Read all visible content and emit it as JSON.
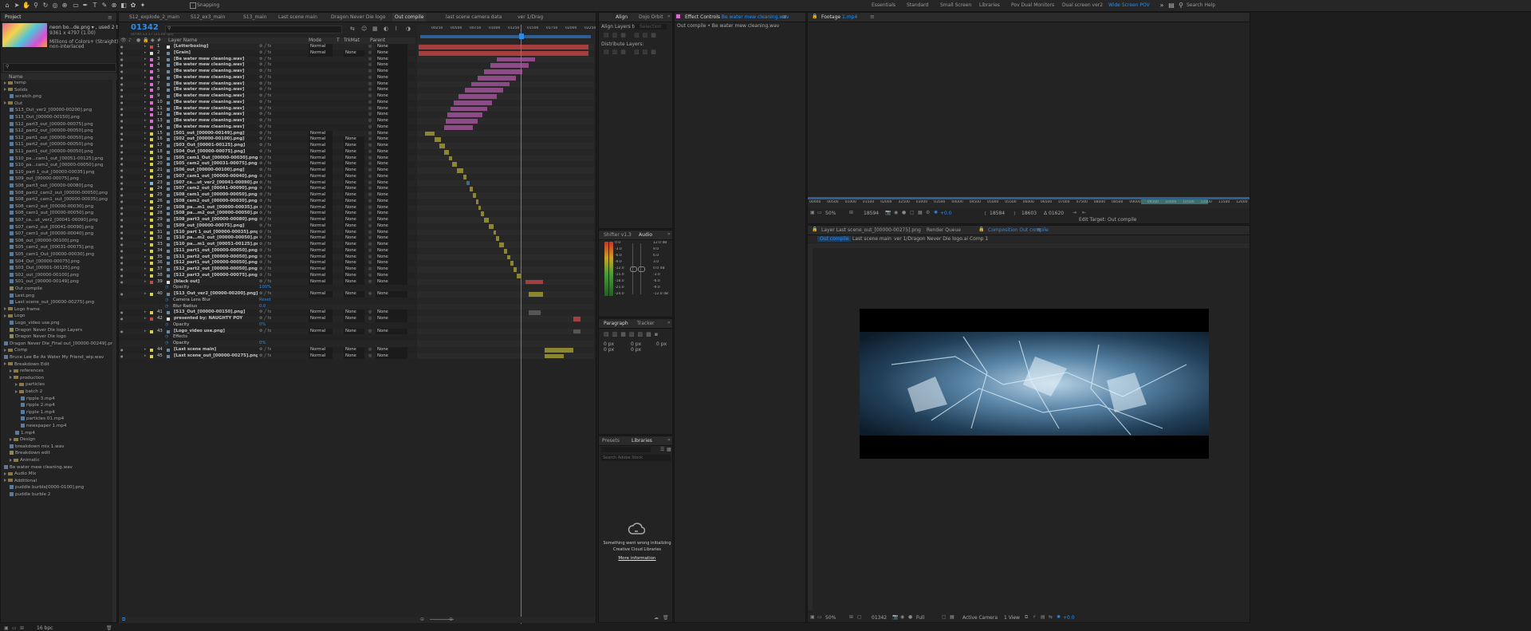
{
  "workspaces": [
    "Essentials",
    "Standard",
    "Small Screen",
    "Libraries",
    "Pov Dual Monitors",
    "Dual screen ver2",
    "Wide Screen POV"
  ],
  "snapping": "Snapping",
  "search_help": "Search Help",
  "project": {
    "tab": "Project",
    "thumb_name": "neon bo...de.png ▾ , used 2 times",
    "thumb_dims": "9361 x 4797 (1.00)",
    "thumb_colors": "Millions of Colors+ (Straight)",
    "thumb_interlace": "non-interlaced",
    "col_name": "Name",
    "bpc": "16 bpc",
    "items": [
      {
        "d": 0,
        "t": "folder",
        "n": "temp"
      },
      {
        "d": 0,
        "t": "folder",
        "n": "Solids"
      },
      {
        "d": 1,
        "t": "file",
        "n": "scratch.png"
      },
      {
        "d": 0,
        "t": "folder",
        "n": "Out"
      },
      {
        "d": 1,
        "t": "file",
        "n": "S13_Out_ver2_[00000-00200].png"
      },
      {
        "d": 1,
        "t": "file",
        "n": "S13_Out_[00000-00150].png"
      },
      {
        "d": 1,
        "t": "file",
        "n": "S12_part3_out_[00000-00075].png"
      },
      {
        "d": 1,
        "t": "file",
        "n": "S12_part2_out_[00000-00050].png"
      },
      {
        "d": 1,
        "t": "file",
        "n": "S12_part1_out_[00000-00050].png"
      },
      {
        "d": 1,
        "t": "file",
        "n": "S11_part2_out_[00000-00050].png"
      },
      {
        "d": 1,
        "t": "file",
        "n": "S11_part1_out_[00000-00050].png"
      },
      {
        "d": 1,
        "t": "file",
        "n": "S10_pa...cam1_out_[00051-00125].png"
      },
      {
        "d": 1,
        "t": "file",
        "n": "S10_pa...cam2_out_[00000-00050].png"
      },
      {
        "d": 1,
        "t": "file",
        "n": "S10_part 1_out_[00000-00035].png"
      },
      {
        "d": 1,
        "t": "file",
        "n": "S09_out_[00000-00075].png"
      },
      {
        "d": 1,
        "t": "file",
        "n": "S08_part3_out_[00000-00080].png"
      },
      {
        "d": 1,
        "t": "file",
        "n": "S08_part2_cam2_out_[00000-00050].png"
      },
      {
        "d": 1,
        "t": "file",
        "n": "S08_part2_cam1_out_[00000-00035].png"
      },
      {
        "d": 1,
        "t": "file",
        "n": "S08_cam2_out_[00000-00030].png"
      },
      {
        "d": 1,
        "t": "file",
        "n": "S08_cam1_out_[00000-00050].png"
      },
      {
        "d": 1,
        "t": "file",
        "n": "S07_ca...ut_ver2_[00041-00090].png"
      },
      {
        "d": 1,
        "t": "file",
        "n": "S07_cam2_out_[00041-00090].png"
      },
      {
        "d": 1,
        "t": "file",
        "n": "S07_cam1_out_[00000-00040].png"
      },
      {
        "d": 1,
        "t": "file",
        "n": "S06_out_[00000-00100].png"
      },
      {
        "d": 1,
        "t": "file",
        "n": "S05_cam2_out_[00031-00075].png"
      },
      {
        "d": 1,
        "t": "file",
        "n": "S05_cam1_Out_[00000-00030].png"
      },
      {
        "d": 1,
        "t": "file",
        "n": "S04_Out_[00000-00075].png"
      },
      {
        "d": 1,
        "t": "file",
        "n": "S03_Out_[00001-00125].png"
      },
      {
        "d": 1,
        "t": "file",
        "n": "S02_out_[00000-00100].png"
      },
      {
        "d": 1,
        "t": "file",
        "n": "S01_out_[00000-00149].png"
      },
      {
        "d": 1,
        "t": "comp",
        "n": "Out compile"
      },
      {
        "d": 1,
        "t": "file",
        "n": "Lest.png"
      },
      {
        "d": 1,
        "t": "file",
        "n": "Last scene_out_[00000-00275].png"
      },
      {
        "d": 0,
        "t": "folder",
        "n": "Logo frame"
      },
      {
        "d": 0,
        "t": "folder",
        "n": "Logo"
      },
      {
        "d": 1,
        "t": "file",
        "n": "Logo_video use.png"
      },
      {
        "d": 1,
        "t": "comp",
        "n": "Dragon Never Die logo Layers"
      },
      {
        "d": 1,
        "t": "comp",
        "n": "Dragon Never Die logo"
      },
      {
        "d": 0,
        "t": "file",
        "n": "Dragon Never Die_Final out_[00000-00249].png"
      },
      {
        "d": 0,
        "t": "folder",
        "n": "Comp"
      },
      {
        "d": 0,
        "t": "file",
        "n": "Bruce Lee Be As Water My Friend_wip.wav"
      },
      {
        "d": 0,
        "t": "folder",
        "n": "Breakdown Edit"
      },
      {
        "d": 1,
        "t": "folder",
        "n": "references"
      },
      {
        "d": 1,
        "t": "folder",
        "n": "production"
      },
      {
        "d": 2,
        "t": "folder",
        "n": "particles"
      },
      {
        "d": 2,
        "t": "folder",
        "n": "batch 2"
      },
      {
        "d": 3,
        "t": "file",
        "n": "ripple 3.mp4"
      },
      {
        "d": 3,
        "t": "file",
        "n": "ripple 2.mp4"
      },
      {
        "d": 3,
        "t": "file",
        "n": "ripple 1.mp4"
      },
      {
        "d": 3,
        "t": "file",
        "n": "particles 01.mp4"
      },
      {
        "d": 3,
        "t": "file",
        "n": "newspaper 1.mp4"
      },
      {
        "d": 2,
        "t": "file",
        "n": "1.mp4"
      },
      {
        "d": 1,
        "t": "folder",
        "n": "Design"
      },
      {
        "d": 1,
        "t": "file",
        "n": "breakdown mix 1.wav"
      },
      {
        "d": 1,
        "t": "comp",
        "n": "Breakdown edit"
      },
      {
        "d": 1,
        "t": "folder",
        "n": "Animatic"
      },
      {
        "d": 0,
        "t": "file",
        "n": "Be water mew cleaning.wav"
      },
      {
        "d": 0,
        "t": "folder",
        "n": "Audio Mix"
      },
      {
        "d": 0,
        "t": "folder",
        "n": "Additional"
      },
      {
        "d": 1,
        "t": "file",
        "n": "puddle burble[0000-0100].png"
      },
      {
        "d": 1,
        "t": "file",
        "n": "puddle burble 2"
      }
    ]
  },
  "timeline": {
    "tabs": [
      "S12_explode_2_main",
      "S12_ex3_main",
      "S13_main",
      "Last scene main",
      "Dragon Never Die logo",
      "Out compile",
      "last scene camera data",
      "ver 1/Drag"
    ],
    "active_tab": 5,
    "timecode": "01342",
    "timecode_sub": "00:00:53:17 (25.00 fps)",
    "col_layer_name": "Layer Name",
    "col_mode": "Mode",
    "col_t": "T",
    "col_trkmat": "TrkMat",
    "col_parent": "Parent",
    "ruler": [
      "00250",
      "00500",
      "00750",
      "01000",
      "01250",
      "01500",
      "01750",
      "02000",
      "02250"
    ],
    "layers": [
      {
        "n": "1",
        "name": "[Letterboxing]",
        "c": "#c24b4b",
        "mode": "Normal",
        "trk": "",
        "par": "None"
      },
      {
        "n": "2",
        "name": "[Grain]",
        "c": "#d9d9d9",
        "mode": "Normal",
        "trk": "None",
        "par": "None"
      },
      {
        "n": "3",
        "name": "[Be water mew cleaning.wav]",
        "c": "#d56fd0",
        "mode": "",
        "trk": "",
        "par": "None"
      },
      {
        "n": "4",
        "name": "[Be water mew cleaning.wav]",
        "c": "#d56fd0",
        "mode": "",
        "trk": "",
        "par": "None"
      },
      {
        "n": "5",
        "name": "[Be water mew cleaning.wav]",
        "c": "#d56fd0",
        "mode": "",
        "trk": "",
        "par": "None"
      },
      {
        "n": "6",
        "name": "[Be water mew cleaning.wav]",
        "c": "#d56fd0",
        "mode": "",
        "trk": "",
        "par": "None"
      },
      {
        "n": "7",
        "name": "[Be water mew cleaning.wav]",
        "c": "#d56fd0",
        "mode": "",
        "trk": "",
        "par": "None"
      },
      {
        "n": "8",
        "name": "[Be water mew cleaning.wav]",
        "c": "#d56fd0",
        "mode": "",
        "trk": "",
        "par": "None"
      },
      {
        "n": "9",
        "name": "[Be water mew cleaning.wav]",
        "c": "#d56fd0",
        "mode": "",
        "trk": "",
        "par": "None"
      },
      {
        "n": "10",
        "name": "[Be water mew cleaning.wav]",
        "c": "#d56fd0",
        "mode": "",
        "trk": "",
        "par": "None"
      },
      {
        "n": "11",
        "name": "[Be water mew cleaning.wav]",
        "c": "#d56fd0",
        "mode": "",
        "trk": "",
        "par": "None"
      },
      {
        "n": "12",
        "name": "[Be water mew cleaning.wav]",
        "c": "#d56fd0",
        "mode": "",
        "trk": "",
        "par": "None"
      },
      {
        "n": "13",
        "name": "[Be water mew cleaning.wav]",
        "c": "#d56fd0",
        "mode": "",
        "trk": "",
        "par": "None"
      },
      {
        "n": "14",
        "name": "[Be water mew cleaning.wav]",
        "c": "#d56fd0",
        "mode": "",
        "trk": "",
        "par": "None"
      },
      {
        "n": "15",
        "name": "[S01_out_[00000-00149].png]",
        "c": "#d8cf4a",
        "mode": "Normal",
        "trk": "",
        "par": "None"
      },
      {
        "n": "16",
        "name": "[S02_out_[00000-00100].png]",
        "c": "#d8cf4a",
        "mode": "Normal",
        "trk": "None",
        "par": "None"
      },
      {
        "n": "17",
        "name": "[S03_Out_[00001-00125].png]",
        "c": "#d8cf4a",
        "mode": "Normal",
        "trk": "None",
        "par": "None"
      },
      {
        "n": "18",
        "name": "[S04_Out_[00000-00075].png]",
        "c": "#d8cf4a",
        "mode": "Normal",
        "trk": "None",
        "par": "None"
      },
      {
        "n": "19",
        "name": "[S05_cam1_Out_[00000-00030].png]",
        "c": "#d8cf4a",
        "mode": "Normal",
        "trk": "None",
        "par": "None"
      },
      {
        "n": "20",
        "name": "[S05_cam2_out_[00031-00075].png]",
        "c": "#d8cf4a",
        "mode": "Normal",
        "trk": "None",
        "par": "None"
      },
      {
        "n": "21",
        "name": "[S06_out_[00000-00100].png]",
        "c": "#d8cf4a",
        "mode": "Normal",
        "trk": "None",
        "par": "None"
      },
      {
        "n": "22",
        "name": "[S07_cam1_out_[00000-00040].png]",
        "c": "#d8cf4a",
        "mode": "Normal",
        "trk": "None",
        "par": "None"
      },
      {
        "n": "23",
        "name": "[S07_ca...ut_ver2_[00041-00090].png]",
        "c": "#7fb6d9",
        "mode": "Normal",
        "trk": "None",
        "par": "None"
      },
      {
        "n": "24",
        "name": "[S07_cam2_out_[00041-00090].png]",
        "c": "#d8cf4a",
        "mode": "Normal",
        "trk": "None",
        "par": "None"
      },
      {
        "n": "25",
        "name": "[S08_cam1_out_[00000-00050].png]",
        "c": "#d8cf4a",
        "mode": "Normal",
        "trk": "None",
        "par": "None"
      },
      {
        "n": "26",
        "name": "[S08_cam2_out_[00000-00030].png]",
        "c": "#d8cf4a",
        "mode": "Normal",
        "trk": "None",
        "par": "None"
      },
      {
        "n": "27",
        "name": "[S08_pa...m1_out_[00000-00035].png]",
        "c": "#d8cf4a",
        "mode": "Normal",
        "trk": "None",
        "par": "None"
      },
      {
        "n": "28",
        "name": "[S08_pa...m2_out_[00000-00050].png]",
        "c": "#d8cf4a",
        "mode": "Normal",
        "trk": "None",
        "par": "None"
      },
      {
        "n": "29",
        "name": "[S08_part3_out_[00000-00080].png]",
        "c": "#d8cf4a",
        "mode": "Normal",
        "trk": "None",
        "par": "None"
      },
      {
        "n": "30",
        "name": "[S09_out_[00000-00075].png]",
        "c": "#d8cf4a",
        "mode": "Normal",
        "trk": "None",
        "par": "None"
      },
      {
        "n": "31",
        "name": "[S10_part 1_out_[00000-00035].png]",
        "c": "#d8cf4a",
        "mode": "Normal",
        "trk": "None",
        "par": "None"
      },
      {
        "n": "32",
        "name": "[S10_pa...m2_out_[00000-00050].png]",
        "c": "#d8cf4a",
        "mode": "Normal",
        "trk": "None",
        "par": "None"
      },
      {
        "n": "33",
        "name": "[S10_pa...m1_out_[00051-00125].png]",
        "c": "#d8cf4a",
        "mode": "Normal",
        "trk": "None",
        "par": "None"
      },
      {
        "n": "34",
        "name": "[S11_part1_out_[00000-00050].png]",
        "c": "#d8cf4a",
        "mode": "Normal",
        "trk": "None",
        "par": "None"
      },
      {
        "n": "35",
        "name": "[S11_part2_out_[00000-00050].png]",
        "c": "#d8cf4a",
        "mode": "Normal",
        "trk": "None",
        "par": "None"
      },
      {
        "n": "36",
        "name": "[S12_part1_out_[00000-00050].png]",
        "c": "#d8cf4a",
        "mode": "Normal",
        "trk": "None",
        "par": "None"
      },
      {
        "n": "37",
        "name": "[S12_part2_out_[00000-00050].png]",
        "c": "#d8cf4a",
        "mode": "Normal",
        "trk": "None",
        "par": "None"
      },
      {
        "n": "38",
        "name": "[S12_part3_out_[00000-00075].png]",
        "c": "#d8cf4a",
        "mode": "Normal",
        "trk": "None",
        "par": "None"
      },
      {
        "n": "39",
        "name": "[black out]",
        "c": "#c24b4b",
        "mode": "Normal",
        "trk": "None",
        "par": "None"
      },
      {
        "n": "",
        "name": "Opacity",
        "c": "",
        "mode": "",
        "trk": "",
        "par": "",
        "sub": true,
        "val": "100%"
      },
      {
        "n": "40",
        "name": "[S13_Out_ver2_[00000-00200].png]",
        "c": "#d8cf4a",
        "mode": "Normal",
        "trk": "None",
        "par": "None"
      },
      {
        "n": "",
        "name": "Camera Lens Blur",
        "c": "",
        "mode": "",
        "trk": "",
        "par": "",
        "sub": true,
        "val": "Reset"
      },
      {
        "n": "",
        "name": "Blur Radius",
        "c": "",
        "mode": "",
        "trk": "",
        "par": "",
        "sub": true,
        "val": "0.0"
      },
      {
        "n": "41",
        "name": "[S13_Out_[00000-00150].png]",
        "c": "#d8cf4a",
        "mode": "Normal",
        "trk": "None",
        "par": "None"
      },
      {
        "n": "42",
        "name": "presented by: NAUGHTY POY",
        "c": "#c24b4b",
        "mode": "Normal",
        "trk": "None",
        "par": "None"
      },
      {
        "n": "",
        "name": "Opacity",
        "c": "",
        "mode": "",
        "trk": "",
        "par": "",
        "sub": true,
        "val": "0%"
      },
      {
        "n": "43",
        "name": "[Logo_video use.png]",
        "c": "#d8cf4a",
        "mode": "Normal",
        "trk": "None",
        "par": "None"
      },
      {
        "n": "",
        "name": "Effects",
        "c": "",
        "mode": "",
        "trk": "",
        "par": "",
        "sub": true,
        "val": ""
      },
      {
        "n": "",
        "name": "Opacity",
        "c": "",
        "mode": "",
        "trk": "",
        "par": "",
        "sub": true,
        "val": "0%"
      },
      {
        "n": "44",
        "name": "[Last scene main]",
        "c": "#d8cf4a",
        "mode": "Normal",
        "trk": "None",
        "par": "None"
      },
      {
        "n": "45",
        "name": "[Last scene_out_[00000-00275].png]",
        "c": "#d8cf4a",
        "mode": "Normal",
        "trk": "None",
        "par": "None"
      }
    ]
  },
  "align": {
    "tabs": [
      "Align",
      "Dojo Orbit"
    ],
    "align_layers_to": "Align Layers to:",
    "selection": "Selection",
    "distribute": "Distribute Layers:"
  },
  "effect_controls": {
    "tab": "Effect Controls",
    "tab_file": "Be water mew cleaning.wav",
    "path": "Out compile • Be water mew cleaning.wav"
  },
  "audio": {
    "tabs": [
      "Shifter v1.3",
      "Audio"
    ],
    "levels_left": [
      "0.0",
      "-3.0",
      "-6.0",
      "-9.0",
      "-12.0",
      "-15.0",
      "-18.0",
      "-21.0",
      "-24.0"
    ],
    "levels_right": [
      "12.0 dB",
      "9.0",
      "6.0",
      "3.0",
      "0.0 dB",
      "-3.0",
      "-6.0",
      "-9.0",
      "-12.0 dB"
    ]
  },
  "paragraph": {
    "tabs": [
      "Paragraph",
      "Tracker"
    ],
    "values": [
      "0 px",
      "0 px",
      "0 px",
      "0 px",
      "0 px"
    ]
  },
  "libraries": {
    "tabs": [
      "Presets",
      "Libraries"
    ],
    "search": "Search Adobe Stock",
    "error1": "Something went wrong initializing",
    "error2": "Creative Cloud Libraries",
    "more": "More information"
  },
  "footage": {
    "tab": "Footage",
    "file": "1.mp4",
    "ruler": [
      "00000",
      "00500",
      "01000",
      "01500",
      "02000",
      "02500",
      "03000",
      "03500",
      "04000",
      "04500",
      "05000",
      "05500",
      "06000",
      "06500",
      "07000",
      "07500",
      "08000",
      "08500",
      "09000",
      "09500",
      "10000",
      "10500",
      "11000",
      "11500",
      "12000"
    ],
    "zoom": "50%",
    "tc_in": "18594",
    "tc_a": "18584",
    "tc_b": "18603",
    "tc_c": "Δ 01620",
    "plus": "+0.0",
    "edit_target": "Edit Target: Out compile"
  },
  "composition": {
    "tabs": [
      "Layer Last scene_out_[00000-00275].png",
      "Render Queue",
      "Composition Out compile"
    ],
    "breadcrumbs": [
      "Out compile",
      "Last scene main",
      "ver 1/Dragon Never Die logo.ai Comp 1"
    ],
    "zoom": "50%",
    "timecode": "01342",
    "quality": "Full",
    "camera": "Active Camera",
    "view": "1 View",
    "plus": "+0.0"
  },
  "colors": {
    "accent": "#2d8ceb",
    "bg": "#1d1d1d",
    "panel": "#232323"
  }
}
